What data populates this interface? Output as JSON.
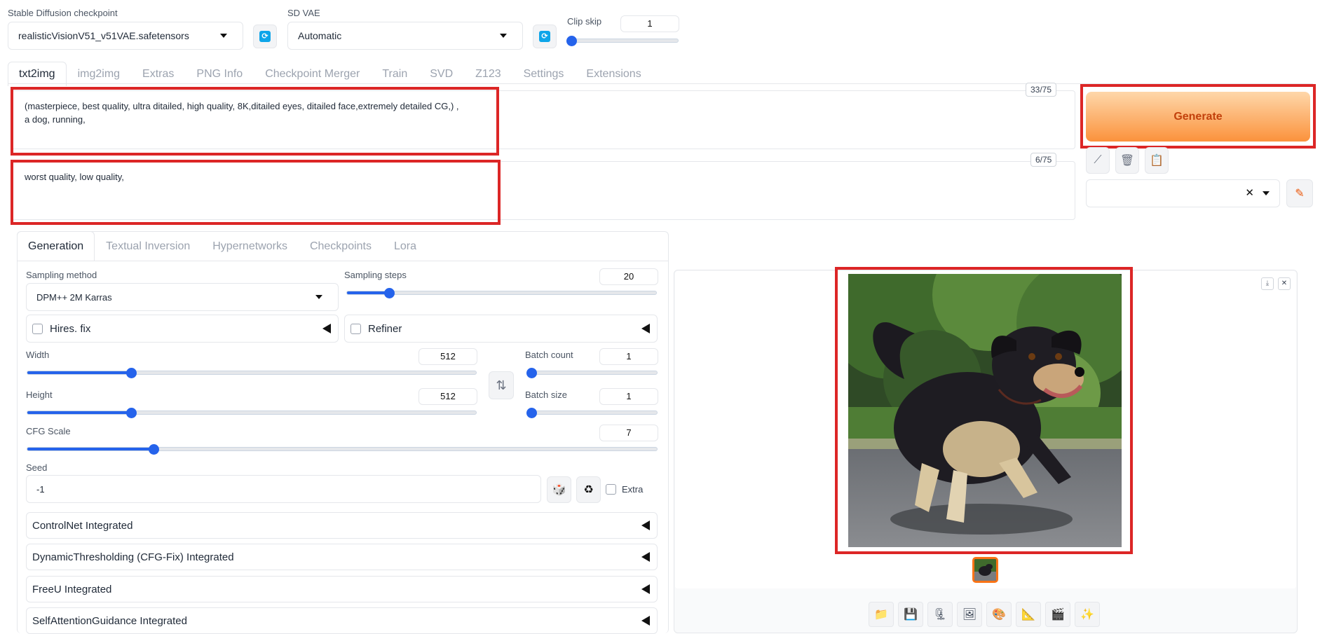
{
  "top": {
    "checkpoint_label": "Stable Diffusion checkpoint",
    "checkpoint_value": "realisticVisionV51_v51VAE.safetensors",
    "vae_label": "SD VAE",
    "vae_value": "Automatic",
    "clip_skip_label": "Clip skip",
    "clip_skip_value": "1"
  },
  "main_tabs": [
    {
      "label": "txt2img"
    },
    {
      "label": "img2img"
    },
    {
      "label": "Extras"
    },
    {
      "label": "PNG Info"
    },
    {
      "label": "Checkpoint Merger"
    },
    {
      "label": "Train"
    },
    {
      "label": "SVD"
    },
    {
      "label": "Z123"
    },
    {
      "label": "Settings"
    },
    {
      "label": "Extensions"
    }
  ],
  "prompt": {
    "value": "(masterpiece, best quality, ultra ditailed, high quality, 8K,ditailed eyes, ditailed face,extremely detailed CG,) ,\na dog, running,",
    "counter": "33/75"
  },
  "negative_prompt": {
    "value": "worst quality, low quality,",
    "counter": "6/75"
  },
  "generate_label": "Generate",
  "sub_tabs": [
    {
      "label": "Generation"
    },
    {
      "label": "Textual Inversion"
    },
    {
      "label": "Hypernetworks"
    },
    {
      "label": "Checkpoints"
    },
    {
      "label": "Lora"
    }
  ],
  "generation": {
    "sampling_method_label": "Sampling method",
    "sampling_method_value": "DPM++ 2M Karras",
    "sampling_steps_label": "Sampling steps",
    "sampling_steps_value": "20",
    "hires_label": "Hires. fix",
    "refiner_label": "Refiner",
    "width_label": "Width",
    "width_value": "512",
    "height_label": "Height",
    "height_value": "512",
    "batch_count_label": "Batch count",
    "batch_count_value": "1",
    "batch_size_label": "Batch size",
    "batch_size_value": "1",
    "cfg_label": "CFG Scale",
    "cfg_value": "7",
    "seed_label": "Seed",
    "seed_value": "-1",
    "extra_label": "Extra",
    "swap_glyph": "⇅",
    "dice_glyph": "🎲",
    "recycle_glyph": "♻"
  },
  "sliders": {
    "clip_skip": 0.0,
    "sampling_steps": 0.136,
    "width": 0.231,
    "height": 0.231,
    "batch_count": 0.0,
    "batch_size": 0.0,
    "cfg": 0.2
  },
  "accordions": [
    {
      "label": "ControlNet Integrated"
    },
    {
      "label": "DynamicThresholding (CFG-Fix) Integrated"
    },
    {
      "label": "FreeU Integrated"
    },
    {
      "label": "SelfAttentionGuidance Integrated"
    }
  ],
  "toolbar_icons": [
    {
      "name": "folder-icon",
      "glyph": "📁"
    },
    {
      "name": "save-icon",
      "glyph": "💾"
    },
    {
      "name": "zip-icon",
      "glyph": "🗜"
    },
    {
      "name": "send-to-img2img-icon",
      "glyph": "🖼"
    },
    {
      "name": "send-to-inpaint-icon",
      "glyph": "🎨"
    },
    {
      "name": "send-to-extras-icon",
      "glyph": "📐"
    },
    {
      "name": "send-to-svd-icon",
      "glyph": "🎬"
    },
    {
      "name": "sparkle-icon",
      "glyph": "✨"
    }
  ],
  "colors": {
    "accent": "#2563eb",
    "generate_start": "#fed7aa",
    "generate_end": "#fb923c",
    "highlight": "#dc2626"
  }
}
